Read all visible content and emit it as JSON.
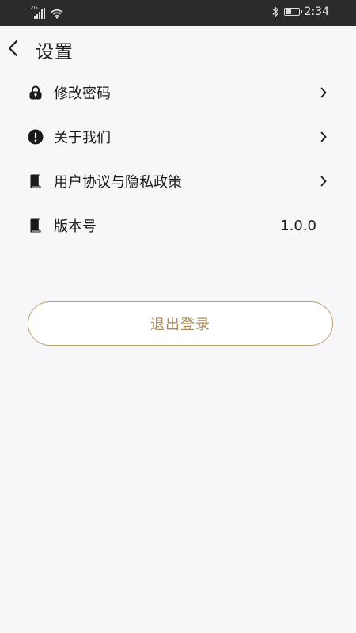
{
  "status_bar": {
    "network": "2G",
    "time": "2:34",
    "battery_level": 0.5
  },
  "header": {
    "title": "设置",
    "back_icon": "chevron-left-icon"
  },
  "settings": {
    "items": [
      {
        "label": "修改密码",
        "icon": "lock-icon",
        "has_chevron": true
      },
      {
        "label": "关于我们",
        "icon": "info-alert-icon",
        "has_chevron": true
      },
      {
        "label": "用户协议与隐私政策",
        "icon": "book-icon",
        "has_chevron": true
      },
      {
        "label": "版本号",
        "icon": "book-icon",
        "value": "1.0.0"
      }
    ]
  },
  "logout": {
    "label": "退出登录",
    "color": "#a8895a",
    "border_color": "#b8a173"
  },
  "colors": {
    "background": "#f7f6f8",
    "status_bar": "#2b2b2b",
    "text": "#1a1a1a"
  }
}
